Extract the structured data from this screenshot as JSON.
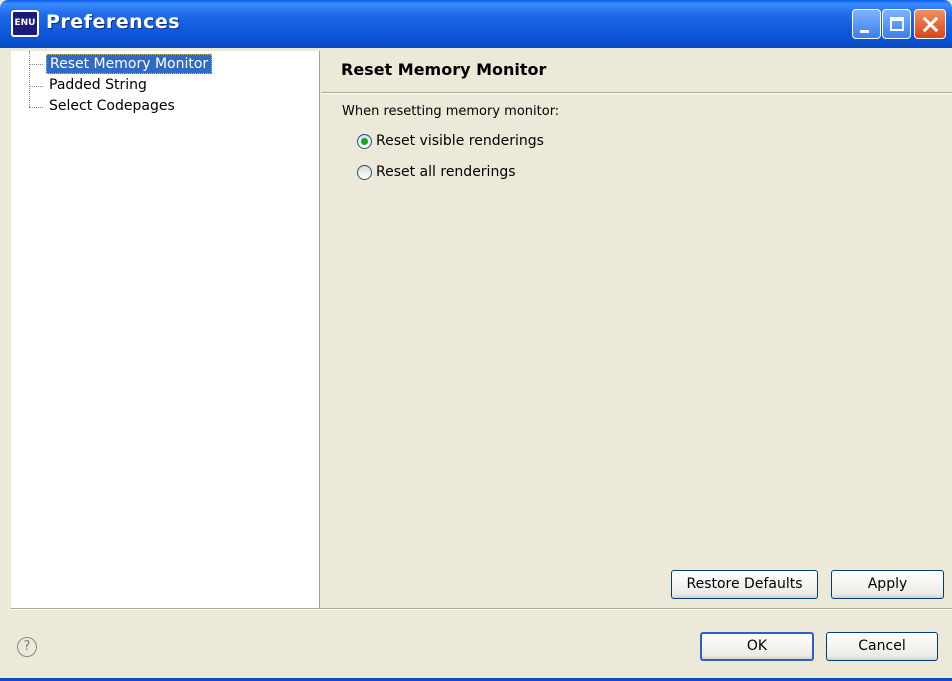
{
  "window": {
    "title": "Preferences",
    "app_icon_text": "ENU"
  },
  "tree": {
    "items": [
      {
        "label": "Reset Memory Monitor",
        "selected": true
      },
      {
        "label": "Padded String",
        "selected": false
      },
      {
        "label": "Select Codepages",
        "selected": false
      }
    ]
  },
  "page": {
    "title": "Reset Memory Monitor",
    "description": "When resetting memory monitor:",
    "options": [
      {
        "label": "Reset visible renderings",
        "checked": true
      },
      {
        "label": "Reset all renderings",
        "checked": false
      }
    ],
    "restore_defaults_label": "Restore Defaults",
    "apply_label": "Apply"
  },
  "footer": {
    "help_symbol": "?",
    "ok_label": "OK",
    "cancel_label": "Cancel"
  }
}
